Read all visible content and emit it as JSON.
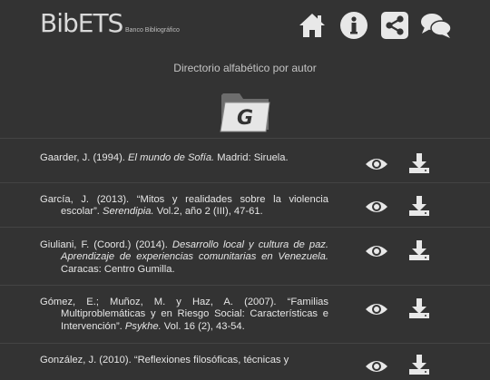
{
  "header": {
    "logo_text": "BibETS",
    "logo_sub": "Banco Bibliográfico",
    "icons": [
      "home-icon",
      "info-icon",
      "share-icon",
      "chat-icon"
    ]
  },
  "page": {
    "subtitle": "Directorio alfabético por autor",
    "letter": "G"
  },
  "references": [
    {
      "pre": "Gaarder, J. (1994). ",
      "title": "El mundo de Sofía.",
      "post": " Madrid: Siruela."
    },
    {
      "pre": "García, J. (2013). “Mitos y realidades sobre la violencia escolar”. ",
      "title": "Serendipia.",
      "post": " Vol.2, año 2 (III), 47-61."
    },
    {
      "pre": "Giuliani, F. (Coord.) (2014). ",
      "title": "Desarrollo local y cultura de paz. Aprendizaje de experiencias comunitarias en Venezuela.",
      "post": " Caracas: Centro Gumilla."
    },
    {
      "pre": "Gómez, E.; Muñoz, M. y Haz, A. (2007). “Familias Multiproblemáticas y en Riesgo Social: Características e Intervención”. ",
      "title": "Psykhe.",
      "post": " Vol. 16 (2), 43-54."
    },
    {
      "pre": "González, J. (2010). “Reflexiones filosóficas, técnicas y",
      "title": "",
      "post": ""
    }
  ],
  "colors": {
    "background": "#333333",
    "text": "#e6e6e6",
    "icon": "#e8e8e8"
  }
}
